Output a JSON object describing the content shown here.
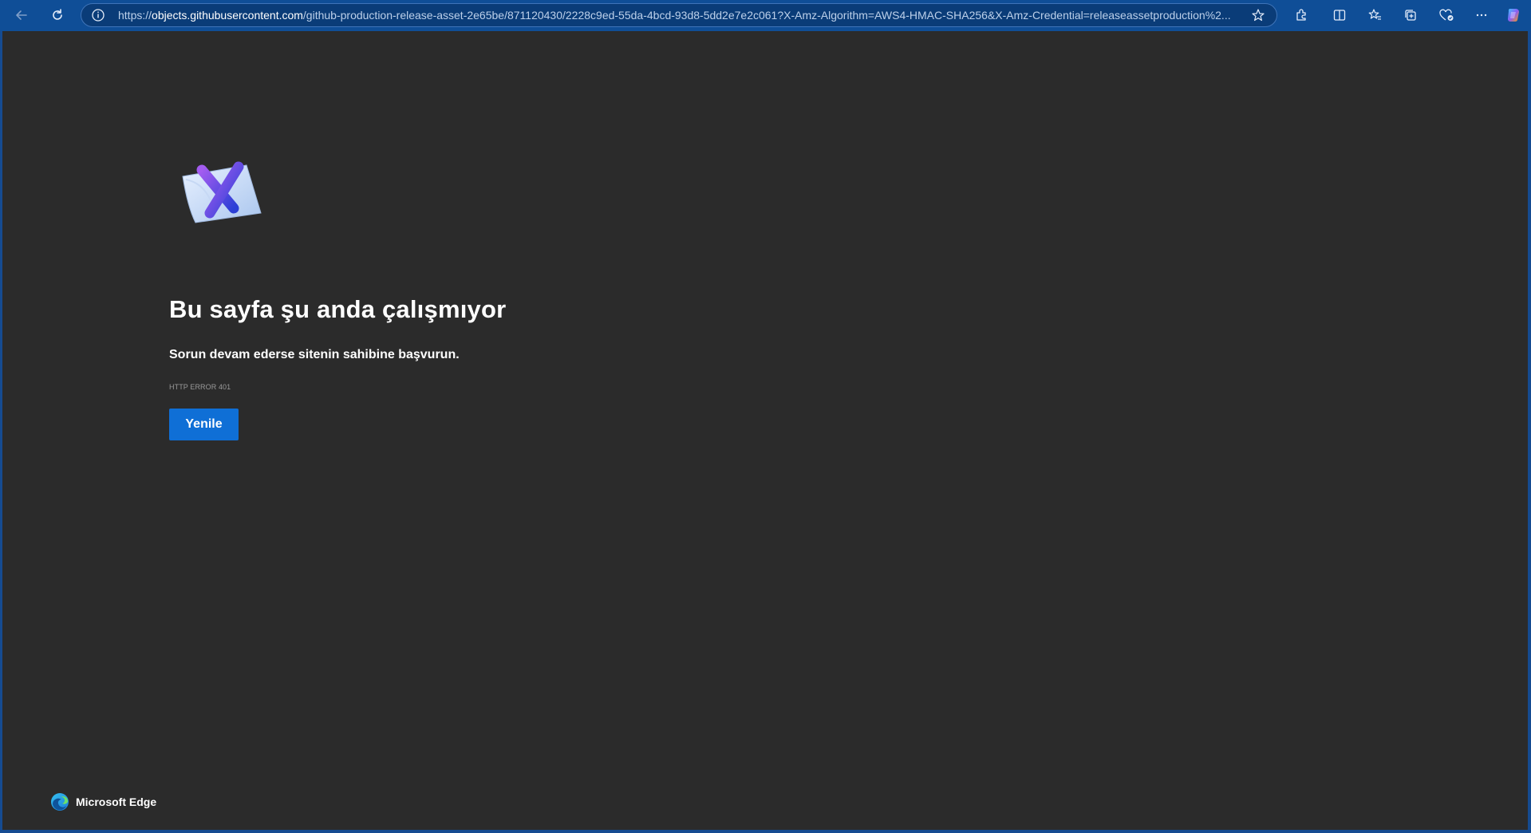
{
  "browser": {
    "url_scheme": "https://",
    "url_host": "objects.githubusercontent.com",
    "url_path": "/github-production-release-asset-2e65be/871120430/2228c9ed-55da-4bcd-93d8-5dd2e7e2c061?X-Amz-Algorithm=AWS4-HMAC-SHA256&X-Amz-Credential=releaseassetproduction%2...",
    "accent_color": "#0f4e97"
  },
  "toolbar": {
    "icons": [
      "back-icon",
      "refresh-icon",
      "info-icon",
      "favorite-star-icon",
      "extensions-icon",
      "split-screen-icon",
      "favorites-icon",
      "collections-icon",
      "browser-essentials-icon",
      "more-icon",
      "copilot-icon"
    ]
  },
  "error_page": {
    "headline": "Bu sayfa şu anda çalışmıyor",
    "message": "Sorun devam ederse sitenin sahibine başvurun.",
    "error_code": "HTTP ERROR 401",
    "reload_label": "Yenile",
    "button_color": "#0f6fd6",
    "background_color": "#2b2b2b"
  },
  "footer": {
    "brand_label": "Microsoft Edge"
  }
}
